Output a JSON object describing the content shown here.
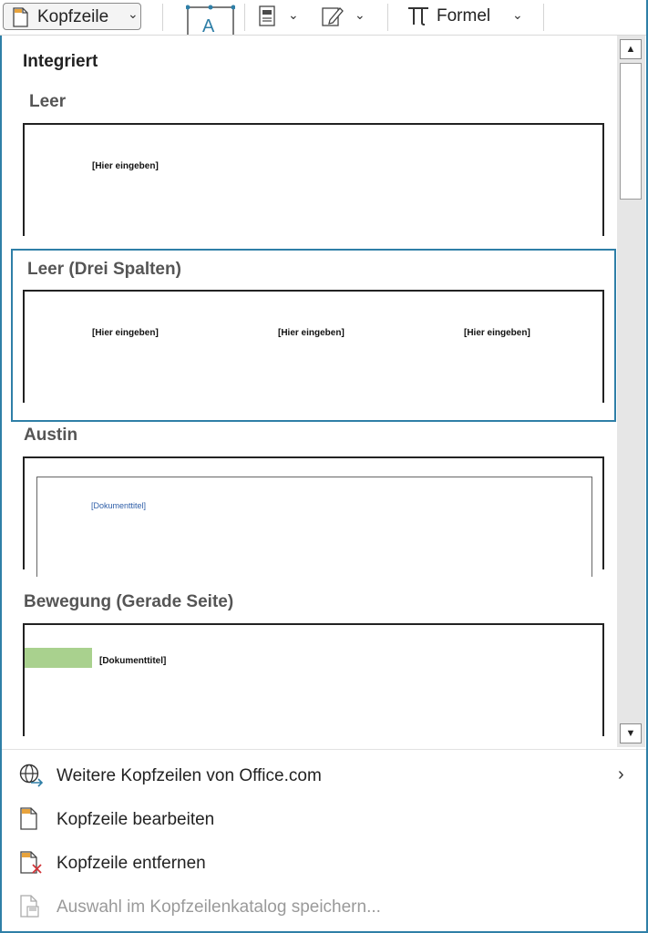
{
  "toolbar": {
    "header_button_label": "Kopfzeile",
    "formula_label": "Formel"
  },
  "gallery": {
    "section_title": "Integriert",
    "items": [
      {
        "title": "Leer",
        "placeholders": [
          "[Hier eingeben]"
        ]
      },
      {
        "title": "Leer (Drei Spalten)",
        "placeholders": [
          "[Hier eingeben]",
          "[Hier eingeben]",
          "[Hier eingeben]"
        ]
      },
      {
        "title": "Austin",
        "placeholders": [
          "[Dokumenttitel]"
        ]
      },
      {
        "title": "Bewegung (Gerade Seite)",
        "placeholders": [
          "[Dokumenttitel]"
        ]
      }
    ],
    "selected_item": "Leer (Drei Spalten)",
    "colors": {
      "selection_border": "#2f7fa7",
      "accent_green": "#a9d18e",
      "title_blue": "#2e5ea8"
    }
  },
  "menu": {
    "items": [
      {
        "label": "Weitere Kopfzeilen von Office.com",
        "icon": "globe-icon",
        "has_submenu": true,
        "enabled": true
      },
      {
        "label": "Kopfzeile bearbeiten",
        "icon": "header-edit-icon",
        "enabled": true
      },
      {
        "label": "Kopfzeile entfernen",
        "icon": "header-remove-icon",
        "enabled": true
      },
      {
        "label": "Auswahl im Kopfzeilenkatalog speichern...",
        "icon": "header-save-icon",
        "enabled": false
      }
    ]
  }
}
